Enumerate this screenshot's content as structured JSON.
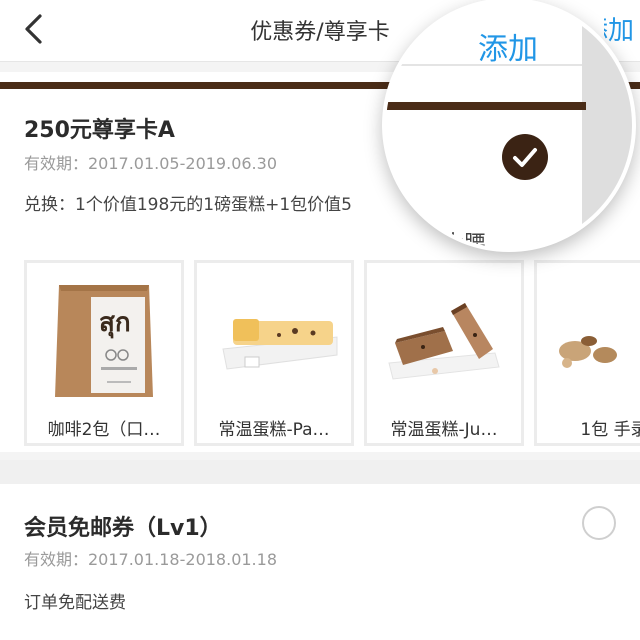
{
  "nav": {
    "title": "优惠券/尊享卡",
    "add_label": "添加"
  },
  "card1": {
    "title": "250元尊享卡A",
    "validity": "有效期：2017.01.05-2019.06.30",
    "desc": "兑换：1个价值198元的1磅蛋糕+1包价值5",
    "selected": true,
    "products": [
      {
        "label": "咖啡2包（口…",
        "icon": "coffee-pack-icon"
      },
      {
        "label": "常温蛋糕-Pa…",
        "icon": "cake-slice-icon"
      },
      {
        "label": "常温蛋糕-Ju…",
        "icon": "cake-bar-icon"
      },
      {
        "label": "1包 手录",
        "icon": "nuts-icon"
      }
    ]
  },
  "magnifier": {
    "add_label": "添加",
    "text": "苎大腰…"
  },
  "card2": {
    "title": "会员免邮券（Lv1）",
    "validity": "有效期：2017.01.18-2018.01.18",
    "desc": "订单免配送费",
    "selected": false
  },
  "colors": {
    "accent": "#2196e6",
    "brand_brown": "#4a2c17",
    "check_bg": "#3b2314"
  }
}
